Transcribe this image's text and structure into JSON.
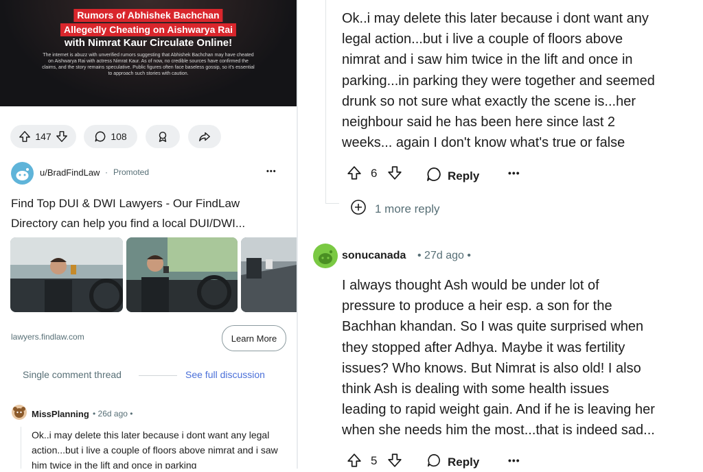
{
  "left": {
    "post": {
      "headline_lines": [
        "Rumors of Abhishek Bachchan",
        "Allegedly Cheating on Aishwarya Rai",
        "with Nimrat Kaur Circulate Online!"
      ],
      "body": "The internet is abuzz with unverified rumors suggesting that Abhishek Bachchan may have cheated on Aishwarya Rai with actress Nimrat Kaur. As of now, no credible sources have confirmed the claims, and the story remains speculative. Public figures often face baseless gossip, so it's essential to approach such stories with caution.",
      "upvotes": "147",
      "comments": "108"
    },
    "ad": {
      "username": "u/BradFindLaw",
      "separator": "·",
      "promoted": "Promoted",
      "menu": "•••",
      "title": "Find Top DUI & DWI Lawyers - Our FindLaw Directory can help you find a local DUI/DWI...",
      "domain": "lawyers.findlaw.com",
      "cta": "Learn More"
    },
    "thread": {
      "label": "Single comment thread",
      "see_full": "See full discussion"
    },
    "comment_preview": {
      "username": "MissPlanning",
      "time": "• 26d ago •",
      "text": "Ok..i may delete this later because i dont want any legal action...but i live a couple of floors above nimrat and i saw him twice in the lift and once in parking"
    }
  },
  "right": {
    "comment1": {
      "lines": [
        "Ok..i may delete this later because i dont want any",
        "legal action...but i live a couple of floors above",
        "nimrat and i saw him twice in the lift and once in",
        "parking...in parking they were together and seemed",
        "drunk so not sure what exactly the scene is...her",
        "neighbour said he has been here since last 2",
        "weeks... again I don't know what's true or false"
      ],
      "votes": "6",
      "reply": "Reply",
      "menu": "•••"
    },
    "more_reply": "1 more reply",
    "comment2": {
      "username": "sonucanada",
      "time": "• 27d ago •",
      "lines": [
        "I always thought Ash would be under lot of",
        "pressure to produce a heir esp. a son for the",
        "Bachhan khandan. So I was quite surprised when",
        "they stopped after Adhya. Maybe it was fertility",
        "issues? Who knows. But Nimrat is also old! I also",
        "think Ash is dealing with some health issues",
        "leading to rapid weight gain. And if he is leaving her",
        "when she needs him the most...that is indeed sad..."
      ],
      "votes": "5",
      "reply": "Reply",
      "menu": "•••"
    }
  },
  "colors": {
    "headline_red": "#d9262c",
    "link_blue": "#4a6fd8",
    "meta_gray": "#576f76",
    "pill_bg": "#edeff1",
    "avatar_blue": "#5fb4d9",
    "avatar_green": "#7ac943"
  }
}
